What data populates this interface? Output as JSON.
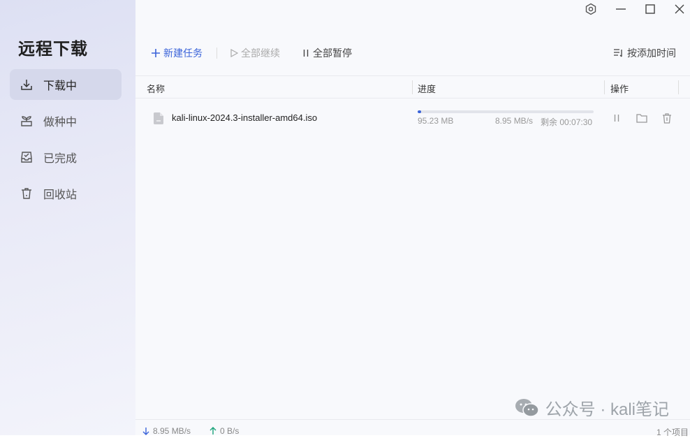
{
  "app": {
    "title": "远程下载"
  },
  "sidebar": {
    "items": [
      {
        "label": "下载中",
        "icon": "download-tray-icon",
        "active": true
      },
      {
        "label": "做种中",
        "icon": "sprout-icon",
        "active": false
      },
      {
        "label": "已完成",
        "icon": "inbox-check-icon",
        "active": false
      },
      {
        "label": "回收站",
        "icon": "trash-icon",
        "active": false
      }
    ]
  },
  "toolbar": {
    "new_task": "新建任务",
    "resume_all": "全部继续",
    "pause_all": "全部暂停",
    "sort": "按添加时间"
  },
  "table": {
    "columns": [
      "名称",
      "进度",
      "操作"
    ],
    "rows": [
      {
        "name": "kali-linux-2024.3-installer-amd64.iso",
        "downloaded": "95.23 MB",
        "speed": "8.95 MB/s",
        "remaining": "剩余 00:07:30",
        "progress": 0.02
      }
    ]
  },
  "status": {
    "download_speed": "8.95 MB/s",
    "upload_speed": "0 B/s",
    "item_count": "1 个项目"
  },
  "watermark": {
    "text": "公众号 · kali笔记"
  },
  "colors": {
    "accent": "#3a63d9",
    "upload": "#1aa37a"
  }
}
